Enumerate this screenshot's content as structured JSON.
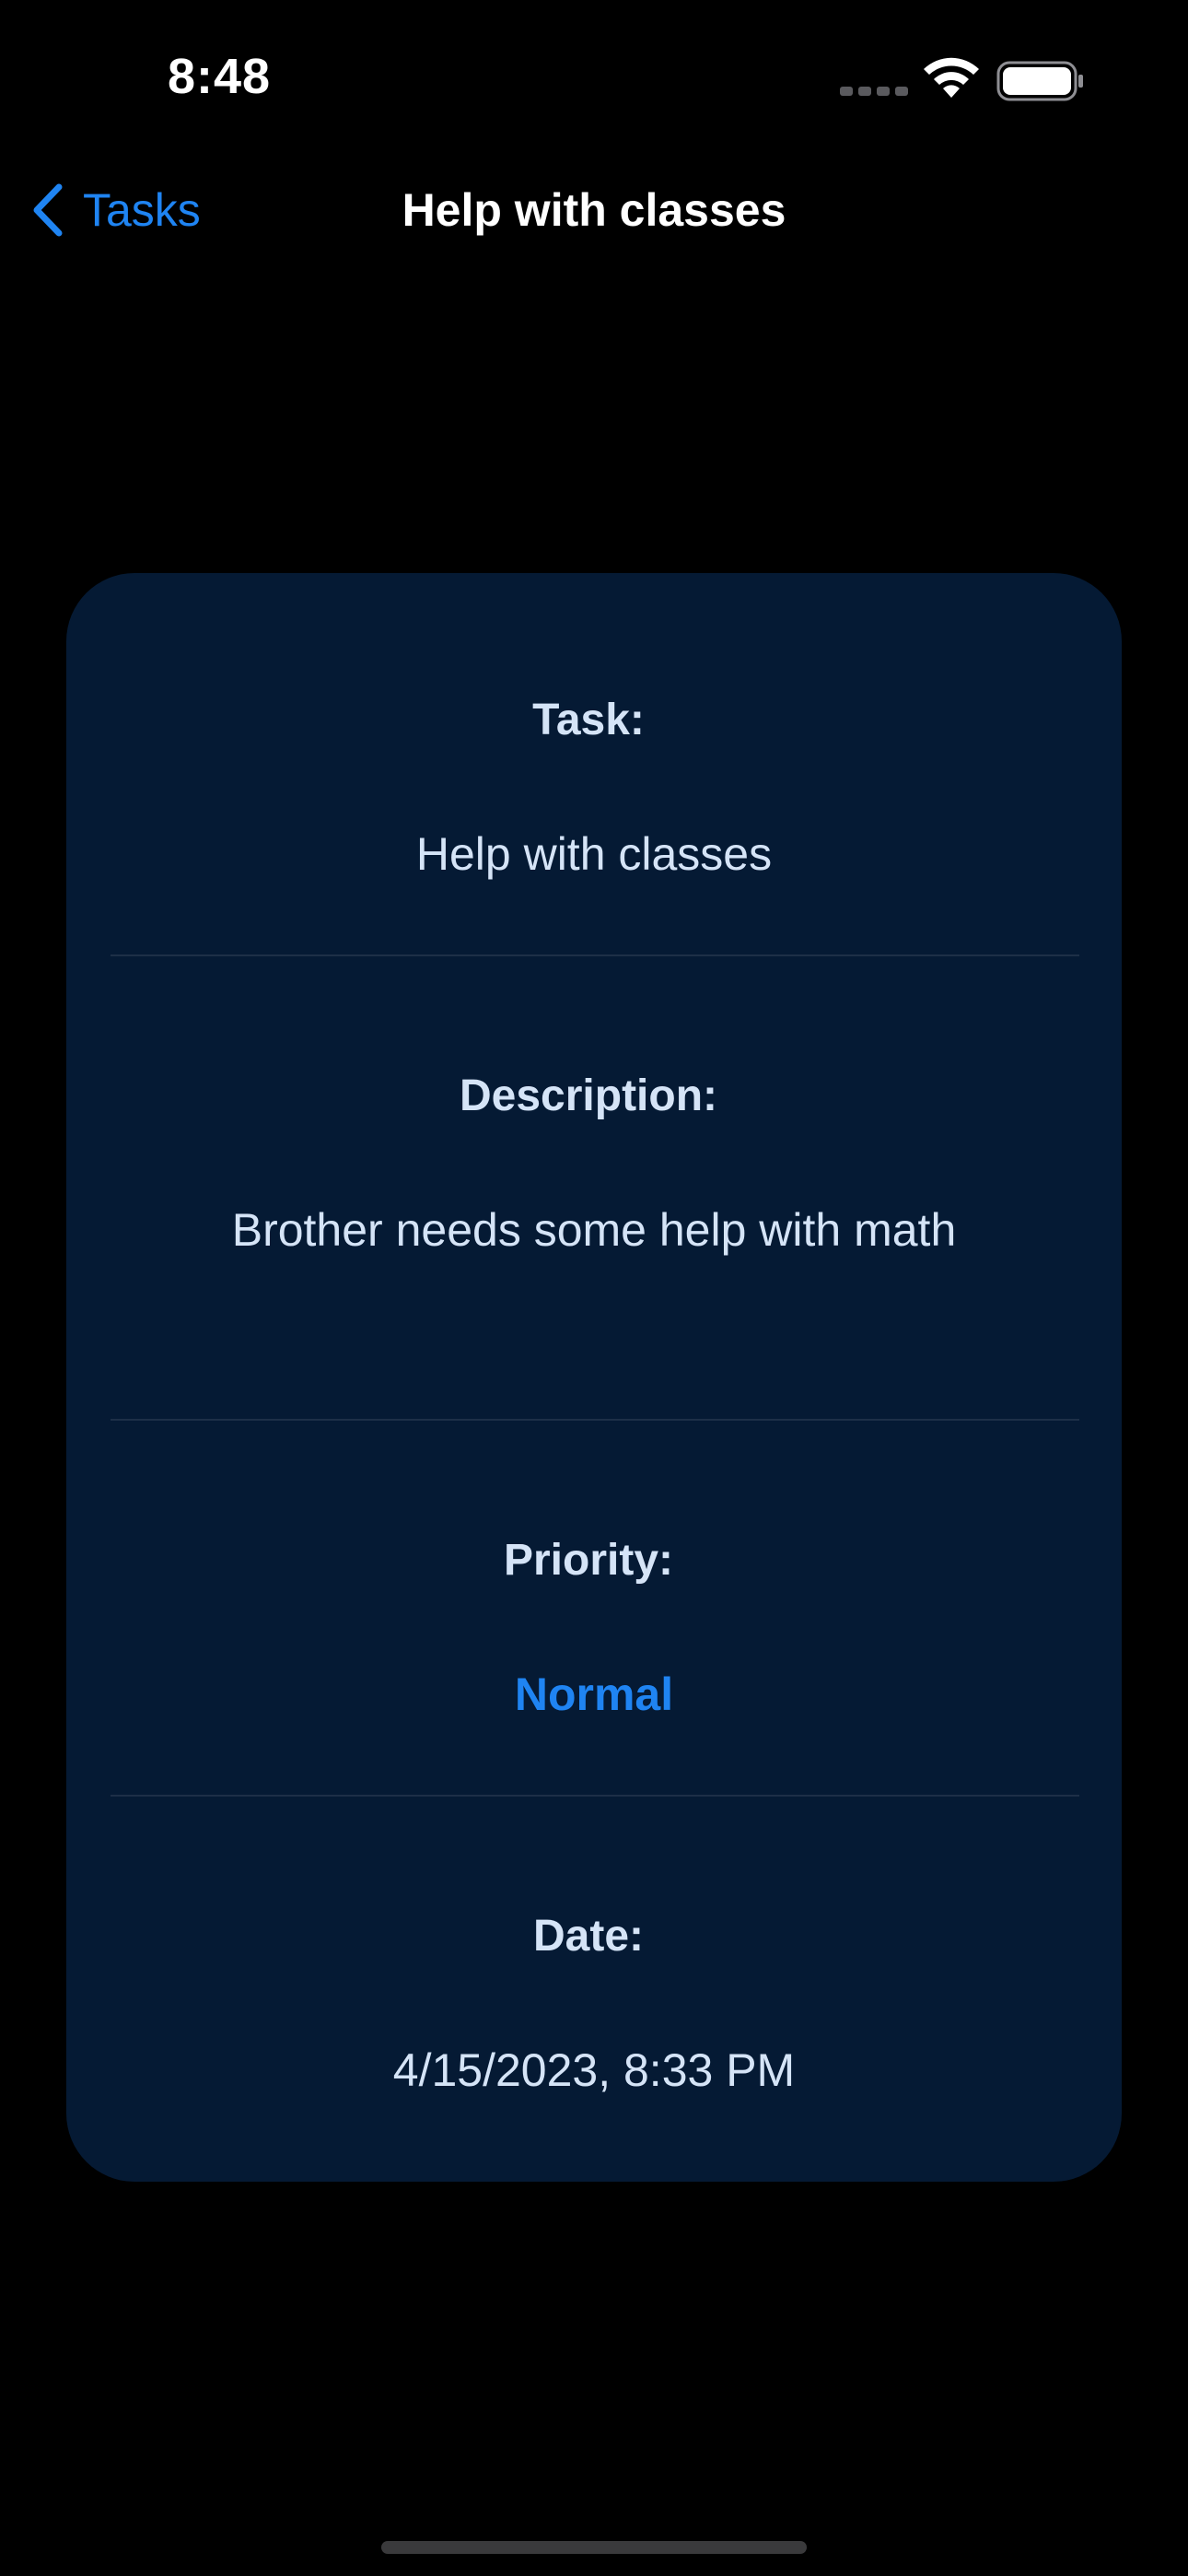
{
  "status_bar": {
    "time": "8:48",
    "icons": [
      "cellular-dots-icon",
      "wifi-icon",
      "battery-icon"
    ]
  },
  "nav": {
    "back_label": "Tasks",
    "back_icon": "chevron-left-icon",
    "title": "Help with classes"
  },
  "task_card": {
    "task": {
      "label": "Task:",
      "value": "Help with classes"
    },
    "description": {
      "label": "Description:",
      "value": "Brother needs some help with math"
    },
    "priority": {
      "label": "Priority:",
      "value": "Normal"
    },
    "date": {
      "label": "Date:",
      "value": "4/15/2023, 8:33 PM"
    }
  },
  "colors": {
    "background": "#000000",
    "card": "#051a34",
    "accent": "#1f84f2",
    "card_text": "#d5e4f7"
  }
}
